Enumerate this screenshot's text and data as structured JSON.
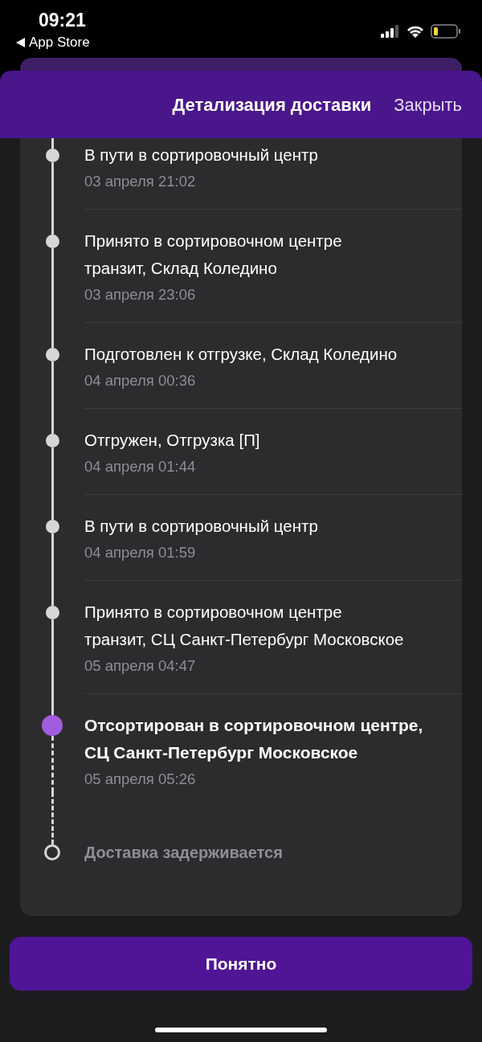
{
  "status_bar": {
    "time": "09:21",
    "back_label": "App Store"
  },
  "header": {
    "title": "Детализация доставки",
    "close_label": "Закрыть"
  },
  "timeline": [
    {
      "kind": "done",
      "title": "В пути в сортировочный центр",
      "date": "03 апреля 21:02"
    },
    {
      "kind": "done",
      "title": "Принято в сортировочном центре транзит, Склад Коледино",
      "date": "03 апреля 23:06"
    },
    {
      "kind": "done",
      "title": "Подготовлен к отгрузке, Склад Коледино",
      "date": "04 апреля 00:36"
    },
    {
      "kind": "done",
      "title": "Отгружен, Отгрузка [П]",
      "date": "04 апреля 01:44"
    },
    {
      "kind": "done",
      "title": "В пути в сортировочный центр",
      "date": "04 апреля 01:59"
    },
    {
      "kind": "done",
      "title": "Принято в сортировочном центре транзит, СЦ Санкт-Петербург Московское",
      "date": "05 апреля 04:47"
    },
    {
      "kind": "current",
      "title": "Отсортирован в сортировочном центре, СЦ Санкт-Петербург Московское",
      "date": "05 апреля 05:26"
    },
    {
      "kind": "pending",
      "title": "Доставка задерживается"
    }
  ],
  "button": {
    "label": "Понятно"
  }
}
